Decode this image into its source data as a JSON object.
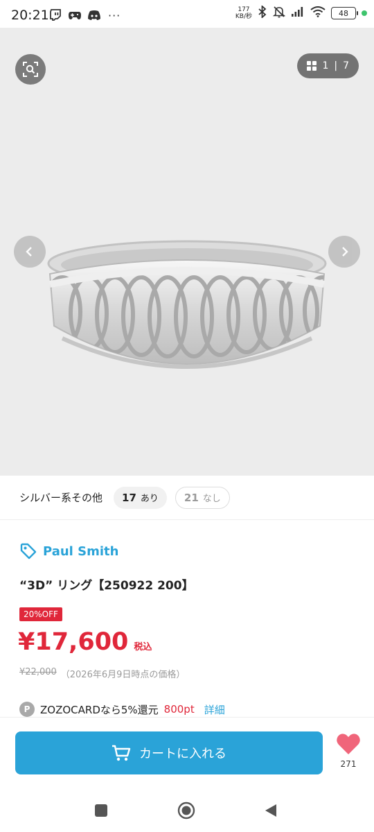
{
  "status_bar": {
    "time": "20:21",
    "speed_value": "177",
    "speed_unit": "KB/秒",
    "battery": "48",
    "icons": [
      "twitch-icon",
      "game-controller-icon",
      "discord-icon",
      "more-dots-icon",
      "bluetooth-icon",
      "mute-icon",
      "signal-icon",
      "wifi-icon",
      "battery-icon"
    ]
  },
  "gallery": {
    "current": "1",
    "separator": "|",
    "total": "7",
    "colors": {
      "background": "#ececec",
      "overlay_button": "#737373"
    }
  },
  "attributes": {
    "label": "シルバー系その他",
    "available": {
      "count": "17",
      "label": "あり"
    },
    "unavailable": {
      "count": "21",
      "label": "なし"
    }
  },
  "product": {
    "brand": "Paul Smith",
    "title": "“3D” リング【250922 200】",
    "discount_badge": "20%OFF",
    "price": "¥17,600",
    "tax_label": "税込",
    "original_price": "¥22,000",
    "price_note": "（2026年6月9日時点の価格）"
  },
  "points": {
    "icon_letter": "P",
    "text": "ZOZOCARDなら5%還元",
    "value": "800pt",
    "link": "詳細"
  },
  "actions": {
    "cart_label": "カートに入れる",
    "favorite_count": "271"
  },
  "colors": {
    "accent_blue": "#2aa3d8",
    "sale_red": "#e0273a",
    "heart_pink": "#f0657a"
  }
}
